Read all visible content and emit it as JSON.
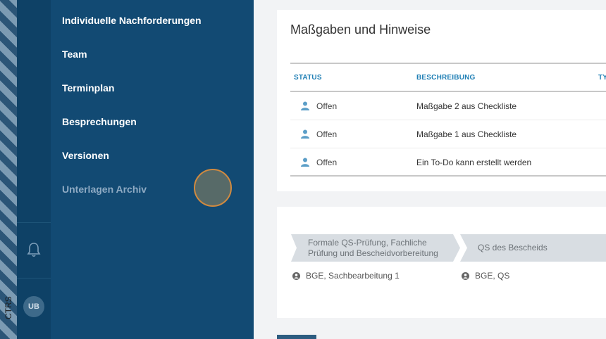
{
  "sidebar": {
    "env_label": "CTRS",
    "avatar_initials": "UB",
    "menu": [
      {
        "label": "Individuelle Nachforderungen",
        "active": true
      },
      {
        "label": "Team",
        "active": true
      },
      {
        "label": "Terminplan",
        "active": true
      },
      {
        "label": "Besprechungen",
        "active": true
      },
      {
        "label": "Versionen",
        "active": true
      },
      {
        "label": "Unterlagen Archiv",
        "active": false
      }
    ]
  },
  "main": {
    "requirements": {
      "title": "Maßgaben und Hinweise",
      "columns": {
        "status": "STATUS",
        "description": "BESCHREIBUNG",
        "type": "TY"
      },
      "rows": [
        {
          "status": "Offen",
          "description": "Maßgabe 2 aus Checkliste"
        },
        {
          "status": "Offen",
          "description": "Maßgabe 1 aus Checkliste"
        },
        {
          "status": "Offen",
          "description": "Ein To-Do kann erstellt werden"
        }
      ]
    },
    "workflow": {
      "steps": [
        {
          "label_line1": "Formale QS-Prüfung, Fachliche",
          "label_line2": "Prüfung und Bescheidvorbereitung",
          "assignee": "BGE, Sachbearbeitung 1"
        },
        {
          "label_line1": "QS des Bescheids",
          "label_line2": "",
          "assignee": "BGE, QS"
        }
      ]
    }
  },
  "colors": {
    "sidebar_bg": "#124a73",
    "rail_bg": "#0e4166",
    "accent_blue": "#1f7fb5",
    "status_icon": "#5b9ec7"
  },
  "icons": {
    "bell": "bell-icon",
    "person": "person-icon",
    "user_circle": "user-circle-icon"
  }
}
